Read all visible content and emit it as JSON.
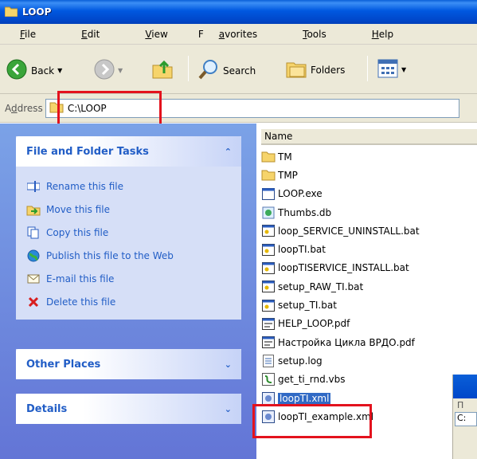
{
  "window": {
    "title": "LOOP"
  },
  "menu": [
    {
      "pre": "",
      "u": "F",
      "post": "ile"
    },
    {
      "pre": "",
      "u": "E",
      "post": "dit"
    },
    {
      "pre": "",
      "u": "V",
      "post": "iew"
    },
    {
      "pre": "F",
      "u": "a",
      "post": "vorites"
    },
    {
      "pre": "",
      "u": "T",
      "post": "ools"
    },
    {
      "pre": "",
      "u": "H",
      "post": "elp"
    }
  ],
  "toolbar": {
    "back_label": "Back",
    "search_label": "Search",
    "folders_label": "Folders"
  },
  "address": {
    "label_pre": "A",
    "label_u": "d",
    "label_post": "dress",
    "value": "C:\\LOOP"
  },
  "tasks_panel": {
    "title": "File and Folder Tasks",
    "items": [
      {
        "label": "Rename this file",
        "icon": "rename-icon"
      },
      {
        "label": "Move this file",
        "icon": "move-icon"
      },
      {
        "label": "Copy this file",
        "icon": "copy-icon"
      },
      {
        "label": "Publish this file to the Web",
        "icon": "publish-web-icon"
      },
      {
        "label": "E-mail this file",
        "icon": "email-icon"
      },
      {
        "label": "Delete this file",
        "icon": "delete-icon"
      }
    ]
  },
  "other_places": {
    "title": "Other Places"
  },
  "details": {
    "title": "Details"
  },
  "filelist": {
    "column_name": "Name",
    "files": [
      {
        "name": "TM",
        "type": "folder"
      },
      {
        "name": "TMP",
        "type": "folder"
      },
      {
        "name": "LOOP.exe",
        "type": "exe"
      },
      {
        "name": "Thumbs.db",
        "type": "db"
      },
      {
        "name": "loop_SERVICE_UNINSTALL.bat",
        "type": "bat"
      },
      {
        "name": "loopTI.bat",
        "type": "bat"
      },
      {
        "name": "loopTISERVICE_INSTALL.bat",
        "type": "bat"
      },
      {
        "name": "setup_RAW_TI.bat",
        "type": "bat"
      },
      {
        "name": "setup_TI.bat",
        "type": "bat"
      },
      {
        "name": "HELP_LOOP.pdf",
        "type": "pdf"
      },
      {
        "name": "Настройка Цикла ВРДО.pdf",
        "type": "pdf"
      },
      {
        "name": "setup.log",
        "type": "log"
      },
      {
        "name": "get_ti_rnd.vbs",
        "type": "vbs"
      },
      {
        "name": "loopTI.xml",
        "type": "xml",
        "selected": true
      },
      {
        "name": "loopTI_example.xml",
        "type": "xml"
      }
    ]
  },
  "overlay_window": {
    "label_1": "П",
    "label_2": "C:"
  },
  "colors": {
    "highlight": "#e3121d",
    "selection": "#316ac5",
    "link": "#215dc6"
  }
}
